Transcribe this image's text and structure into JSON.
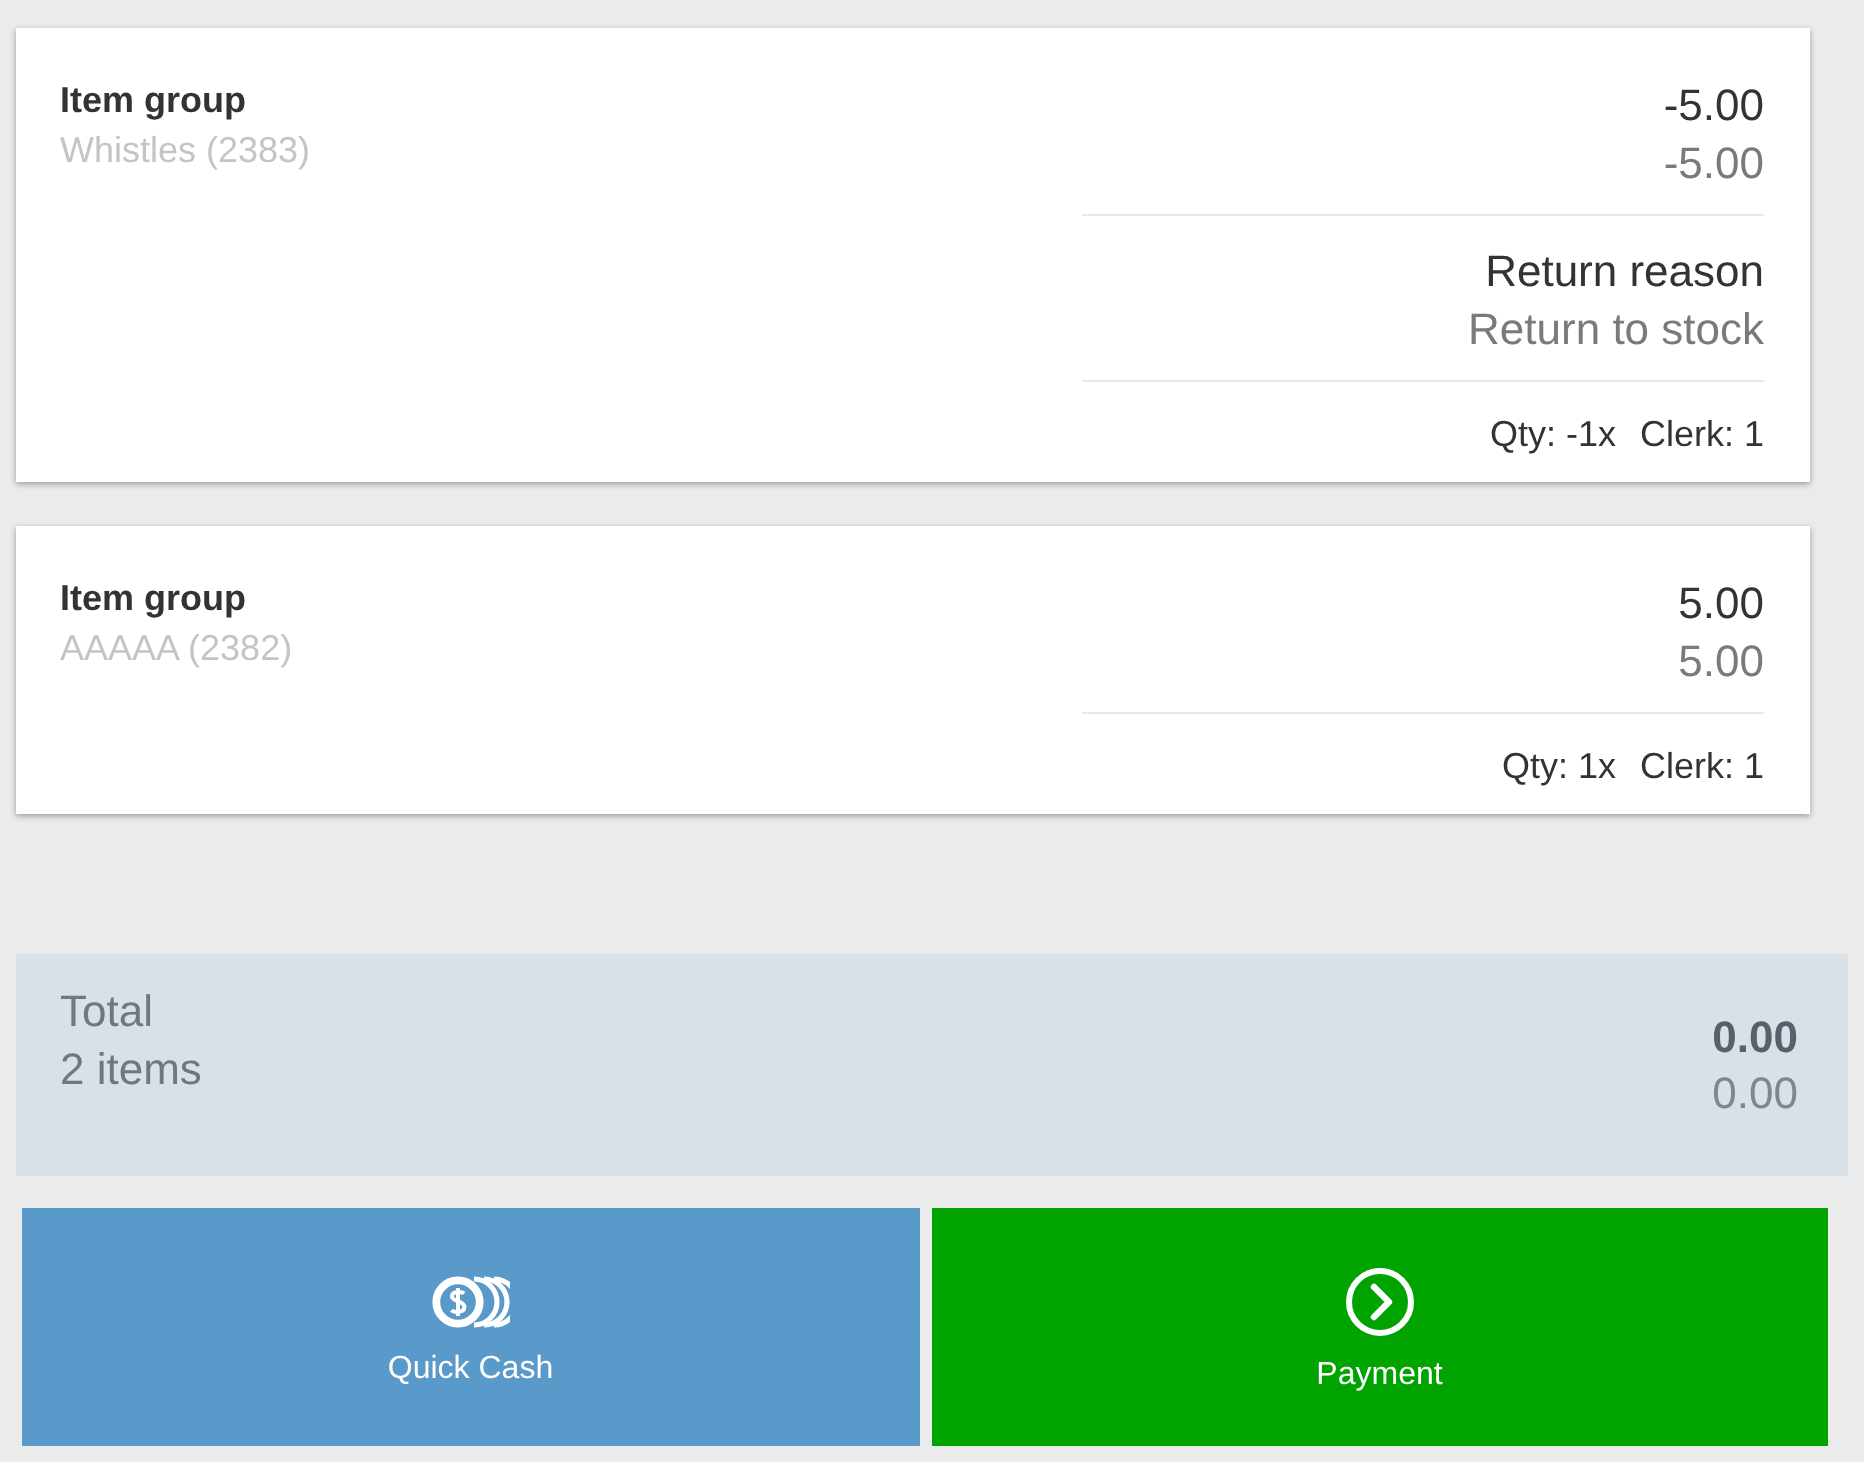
{
  "line_items": [
    {
      "title": "Item group",
      "subtitle": "Whistles (2383)",
      "amount": "-5.00",
      "amount_secondary": "-5.00",
      "details": [
        {
          "label": "Return reason",
          "value": "Return to stock"
        }
      ],
      "qty": "Qty: -1x",
      "clerk": "Clerk: 1"
    },
    {
      "title": "Item group",
      "subtitle": "AAAAA (2382)",
      "amount": "5.00",
      "amount_secondary": "5.00",
      "qty": "Qty: 1x",
      "clerk": "Clerk: 1"
    }
  ],
  "total": {
    "label": "Total",
    "count": "2 items",
    "amount": "0.00",
    "amount_secondary": "0.00"
  },
  "buttons": [
    {
      "label": "Quick Cash",
      "kind": "quick_cash",
      "color": "#5a9aca"
    },
    {
      "label": "Payment",
      "kind": "payment",
      "color": "#00a300"
    }
  ]
}
